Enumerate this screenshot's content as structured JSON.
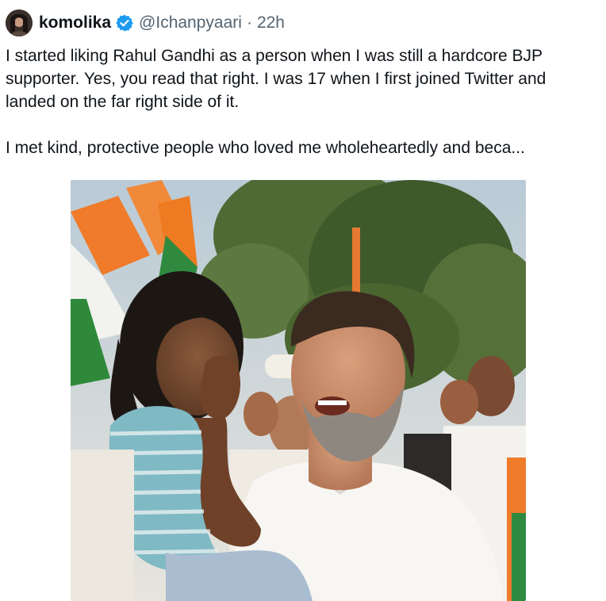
{
  "tweet": {
    "author": {
      "display_name": "komolika",
      "handle": "@Ichanpyaari",
      "avatar_icon": "user-avatar",
      "verified_icon": "verified-badge-icon",
      "verified_color": "#1d9bf0"
    },
    "separator": "·",
    "time": "22h",
    "paragraphs": [
      "I started liking Rahul Gandhi as a person when I was still a hardcore BJP supporter. Yes, you read that right. I was 17 when I first joined Twitter and landed on the far right side of it.",
      "I met kind, protective people who loved me wholeheartedly and beca..."
    ],
    "media": {
      "icon": "photo-image"
    }
  },
  "colors": {
    "text": "#0f1419",
    "secondary_text": "#536471",
    "background": "#ffffff"
  }
}
